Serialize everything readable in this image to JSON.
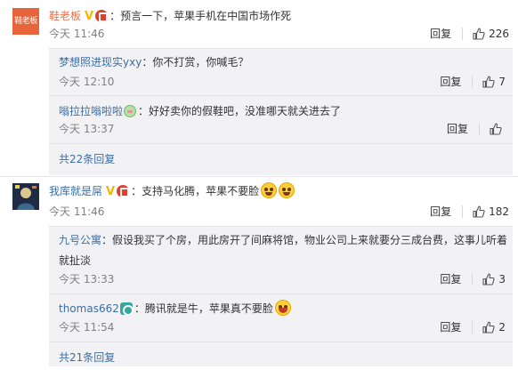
{
  "comments": [
    {
      "avatar_text": "鞋老板",
      "username": "鞋老板",
      "badge": "V",
      "text": "预言一下，苹果手机在中国市场作死",
      "time": "今天 11:46",
      "reply_label": "回复",
      "like_count": "226",
      "replies": [
        {
          "username": "梦想照进现实yxy",
          "text": "你不打赏，你喊毛？",
          "time": "今天 12:10",
          "reply_label": "回复",
          "like_count": "7"
        },
        {
          "username": "嗡拉拉嗡啦啦",
          "text": "好好卖你的假鞋吧，没准哪天就关进去了",
          "time": "今天 13:37",
          "reply_label": "回复",
          "like_count": ""
        }
      ],
      "more_replies": "共22条回复"
    },
    {
      "username": "我库就是屌",
      "badge": "V",
      "text": "支持马化腾，苹果不要脸",
      "time": "今天 11:46",
      "reply_label": "回复",
      "like_count": "182",
      "replies": [
        {
          "username": "九号公寓",
          "text": "假设我买了个房，用此房开了间麻将馆，物业公司上来就要分三成台费，这事儿听着就扯淡",
          "time": "今天 13:33",
          "reply_label": "回复",
          "like_count": "3"
        },
        {
          "username": "thomas662",
          "text": "腾讯就是牛，苹果真不要脸",
          "time": "今天 11:54",
          "reply_label": "回复",
          "like_count": "2"
        }
      ],
      "more_replies": "共21条回复"
    }
  ],
  "separator": "：",
  "icons": {
    "like": "thumbs-up-icon",
    "verified": "verified-v-icon",
    "smiley": "smiley-emoji-icon",
    "laugh": "laughing-emoji-icon"
  },
  "colors": {
    "username_orange": "#eb7350",
    "link_blue": "#3a6ea5",
    "time_gray": "#808080",
    "reply_bg": "#f2f2f5",
    "verified_gold": "#f7b500"
  }
}
